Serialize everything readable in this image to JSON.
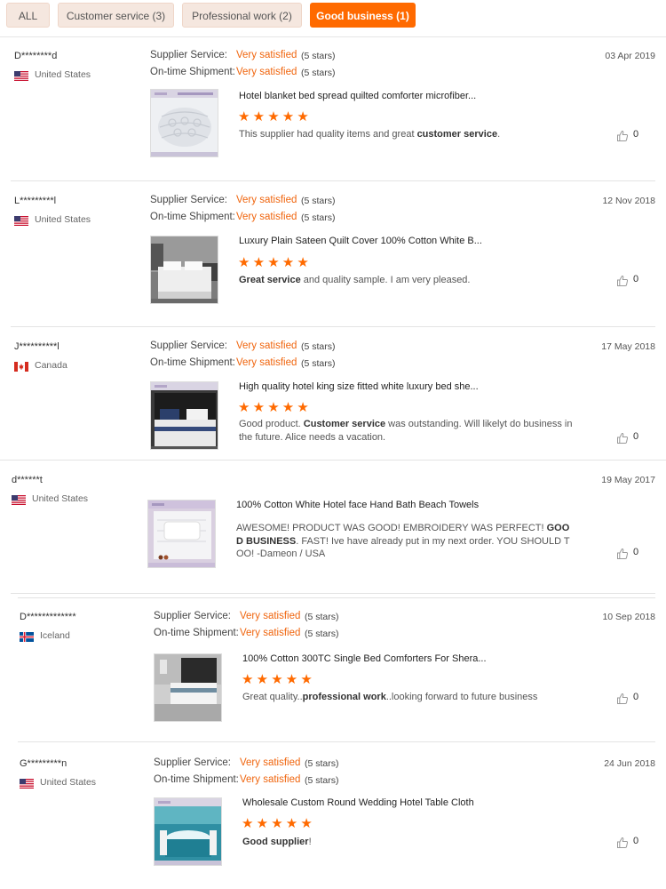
{
  "tabs": [
    {
      "label": "ALL"
    },
    {
      "label": "Customer service (3)"
    },
    {
      "label": "Professional work (2)"
    },
    {
      "label": "Good business (1)"
    }
  ],
  "labels": {
    "supplier": "Supplier Service:",
    "ontime": "On-time Shipment:"
  },
  "reviews": [
    {
      "user": "D********d",
      "country": "United States",
      "date": "03 Apr 2019",
      "supplier_value": "Very satisfied",
      "supplier_stars": "(5 stars)",
      "ontime_value": "Very satisfied",
      "ontime_stars": "(5 stars)",
      "product": "Hotel blanket bed spread quilted comforter microfiber...",
      "comment": [
        {
          "t": "This supplier had quality items and great "
        },
        {
          "t": "customer service",
          "b": true
        },
        {
          "t": "."
        }
      ],
      "likes": "0"
    },
    {
      "user": "L*********l",
      "country": "United States",
      "date": "12 Nov 2018",
      "supplier_value": "Very satisfied",
      "supplier_stars": "(5 stars)",
      "ontime_value": "Very satisfied",
      "ontime_stars": "(5 stars)",
      "product": "Luxury Plain Sateen Quilt Cover 100% Cotton White B...",
      "comment": [
        {
          "t": "Great service",
          "b": true
        },
        {
          "t": " and quality sample. I am very pleased."
        }
      ],
      "likes": "0"
    },
    {
      "user": "J**********l",
      "country": "Canada",
      "date": "17 May 2018",
      "supplier_value": "Very satisfied",
      "supplier_stars": "(5 stars)",
      "ontime_value": "Very satisfied",
      "ontime_stars": "(5 stars)",
      "product": "High quality hotel king size fitted white luxury bed she...",
      "comment": [
        {
          "t": "Good product.  "
        },
        {
          "t": "Customer service",
          "b": true
        },
        {
          "t": " was outstanding.  Will likelyt do business in the future.  Alice needs a vacation."
        }
      ],
      "likes": "0"
    },
    {
      "user": "d******t",
      "country": "United States",
      "date": "19 May 2017",
      "product": "100% Cotton White Hotel face Hand Bath Beach Towels",
      "comment": [
        {
          "t": "AWESOME! PRODUCT WAS GOOD! EMBROIDERY WAS PERFECT! "
        },
        {
          "t": "GOOD BUSINESS",
          "b": true
        },
        {
          "t": ". FAST!  Ive have already put in my next order. YOU SHOULD TOO! -Dameon / USA"
        }
      ],
      "likes": "0"
    },
    {
      "user": "D*************",
      "country": "Iceland",
      "date": "10 Sep 2018",
      "supplier_value": "Very satisfied",
      "supplier_stars": "(5 stars)",
      "ontime_value": "Very satisfied",
      "ontime_stars": "(5 stars)",
      "product": "100% Cotton 300TC Single Bed Comforters For Shera...",
      "comment": [
        {
          "t": "Great quality.."
        },
        {
          "t": "professional work",
          "b": true
        },
        {
          "t": "..looking forward to future business"
        }
      ],
      "likes": "0"
    },
    {
      "user": "G*********n",
      "country": "United States",
      "date": "24 Jun 2018",
      "supplier_value": "Very satisfied",
      "supplier_stars": "(5 stars)",
      "ontime_value": "Very satisfied",
      "ontime_stars": "(5 stars)",
      "product": "Wholesale Custom Round Wedding Hotel Table Cloth",
      "comment": [
        {
          "t": "Good supplier",
          "b": true
        },
        {
          "t": "!"
        }
      ],
      "likes": "0"
    }
  ],
  "colors": {
    "accent": "#ff6a00",
    "satisfied": "#f0650e"
  }
}
